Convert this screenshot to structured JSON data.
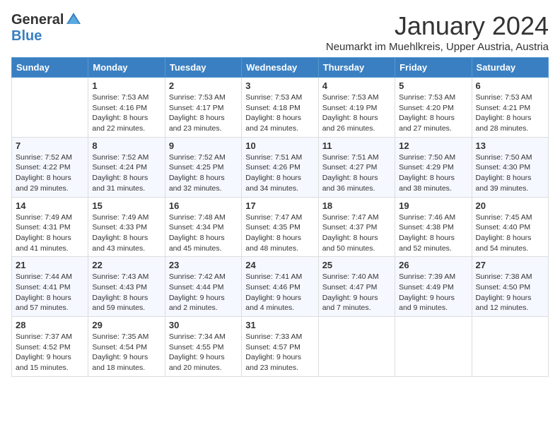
{
  "header": {
    "logo_general": "General",
    "logo_blue": "Blue",
    "month_title": "January 2024",
    "subtitle": "Neumarkt im Muehlkreis, Upper Austria, Austria"
  },
  "days_of_week": [
    "Sunday",
    "Monday",
    "Tuesday",
    "Wednesday",
    "Thursday",
    "Friday",
    "Saturday"
  ],
  "weeks": [
    [
      {
        "num": "",
        "info": ""
      },
      {
        "num": "1",
        "info": "Sunrise: 7:53 AM\nSunset: 4:16 PM\nDaylight: 8 hours\nand 22 minutes."
      },
      {
        "num": "2",
        "info": "Sunrise: 7:53 AM\nSunset: 4:17 PM\nDaylight: 8 hours\nand 23 minutes."
      },
      {
        "num": "3",
        "info": "Sunrise: 7:53 AM\nSunset: 4:18 PM\nDaylight: 8 hours\nand 24 minutes."
      },
      {
        "num": "4",
        "info": "Sunrise: 7:53 AM\nSunset: 4:19 PM\nDaylight: 8 hours\nand 26 minutes."
      },
      {
        "num": "5",
        "info": "Sunrise: 7:53 AM\nSunset: 4:20 PM\nDaylight: 8 hours\nand 27 minutes."
      },
      {
        "num": "6",
        "info": "Sunrise: 7:53 AM\nSunset: 4:21 PM\nDaylight: 8 hours\nand 28 minutes."
      }
    ],
    [
      {
        "num": "7",
        "info": "Sunrise: 7:52 AM\nSunset: 4:22 PM\nDaylight: 8 hours\nand 29 minutes."
      },
      {
        "num": "8",
        "info": "Sunrise: 7:52 AM\nSunset: 4:24 PM\nDaylight: 8 hours\nand 31 minutes."
      },
      {
        "num": "9",
        "info": "Sunrise: 7:52 AM\nSunset: 4:25 PM\nDaylight: 8 hours\nand 32 minutes."
      },
      {
        "num": "10",
        "info": "Sunrise: 7:51 AM\nSunset: 4:26 PM\nDaylight: 8 hours\nand 34 minutes."
      },
      {
        "num": "11",
        "info": "Sunrise: 7:51 AM\nSunset: 4:27 PM\nDaylight: 8 hours\nand 36 minutes."
      },
      {
        "num": "12",
        "info": "Sunrise: 7:50 AM\nSunset: 4:29 PM\nDaylight: 8 hours\nand 38 minutes."
      },
      {
        "num": "13",
        "info": "Sunrise: 7:50 AM\nSunset: 4:30 PM\nDaylight: 8 hours\nand 39 minutes."
      }
    ],
    [
      {
        "num": "14",
        "info": "Sunrise: 7:49 AM\nSunset: 4:31 PM\nDaylight: 8 hours\nand 41 minutes."
      },
      {
        "num": "15",
        "info": "Sunrise: 7:49 AM\nSunset: 4:33 PM\nDaylight: 8 hours\nand 43 minutes."
      },
      {
        "num": "16",
        "info": "Sunrise: 7:48 AM\nSunset: 4:34 PM\nDaylight: 8 hours\nand 45 minutes."
      },
      {
        "num": "17",
        "info": "Sunrise: 7:47 AM\nSunset: 4:35 PM\nDaylight: 8 hours\nand 48 minutes."
      },
      {
        "num": "18",
        "info": "Sunrise: 7:47 AM\nSunset: 4:37 PM\nDaylight: 8 hours\nand 50 minutes."
      },
      {
        "num": "19",
        "info": "Sunrise: 7:46 AM\nSunset: 4:38 PM\nDaylight: 8 hours\nand 52 minutes."
      },
      {
        "num": "20",
        "info": "Sunrise: 7:45 AM\nSunset: 4:40 PM\nDaylight: 8 hours\nand 54 minutes."
      }
    ],
    [
      {
        "num": "21",
        "info": "Sunrise: 7:44 AM\nSunset: 4:41 PM\nDaylight: 8 hours\nand 57 minutes."
      },
      {
        "num": "22",
        "info": "Sunrise: 7:43 AM\nSunset: 4:43 PM\nDaylight: 8 hours\nand 59 minutes."
      },
      {
        "num": "23",
        "info": "Sunrise: 7:42 AM\nSunset: 4:44 PM\nDaylight: 9 hours\nand 2 minutes."
      },
      {
        "num": "24",
        "info": "Sunrise: 7:41 AM\nSunset: 4:46 PM\nDaylight: 9 hours\nand 4 minutes."
      },
      {
        "num": "25",
        "info": "Sunrise: 7:40 AM\nSunset: 4:47 PM\nDaylight: 9 hours\nand 7 minutes."
      },
      {
        "num": "26",
        "info": "Sunrise: 7:39 AM\nSunset: 4:49 PM\nDaylight: 9 hours\nand 9 minutes."
      },
      {
        "num": "27",
        "info": "Sunrise: 7:38 AM\nSunset: 4:50 PM\nDaylight: 9 hours\nand 12 minutes."
      }
    ],
    [
      {
        "num": "28",
        "info": "Sunrise: 7:37 AM\nSunset: 4:52 PM\nDaylight: 9 hours\nand 15 minutes."
      },
      {
        "num": "29",
        "info": "Sunrise: 7:35 AM\nSunset: 4:54 PM\nDaylight: 9 hours\nand 18 minutes."
      },
      {
        "num": "30",
        "info": "Sunrise: 7:34 AM\nSunset: 4:55 PM\nDaylight: 9 hours\nand 20 minutes."
      },
      {
        "num": "31",
        "info": "Sunrise: 7:33 AM\nSunset: 4:57 PM\nDaylight: 9 hours\nand 23 minutes."
      },
      {
        "num": "",
        "info": ""
      },
      {
        "num": "",
        "info": ""
      },
      {
        "num": "",
        "info": ""
      }
    ]
  ]
}
